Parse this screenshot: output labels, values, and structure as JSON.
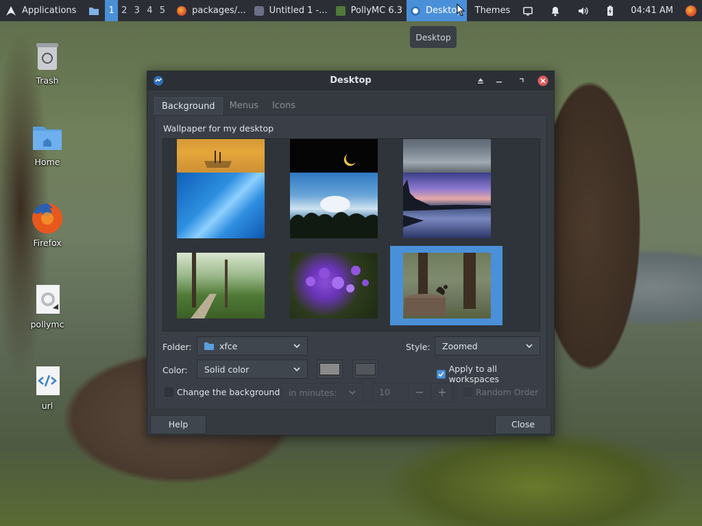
{
  "panel": {
    "applications_label": "Applications",
    "workspaces": [
      "1",
      "2",
      "3",
      "4",
      "5"
    ],
    "active_workspace_index": 0,
    "tasks": [
      {
        "label": "packages/...",
        "icon": "firefox-icon"
      },
      {
        "label": "Untitled 1 -...",
        "icon": "document-icon"
      },
      {
        "label": "PollyMC 6.3",
        "icon": "pollymc-icon"
      },
      {
        "label": "Desktop",
        "icon": "desktop-settings-icon",
        "active": true
      },
      {
        "label": "Themes",
        "icon": ""
      }
    ],
    "clock": "04:41 AM",
    "accent": "#4a90d9"
  },
  "tooltip": "Desktop",
  "desktop_icons": [
    {
      "label": "Trash",
      "icon": "trash-icon"
    },
    {
      "label": "Home",
      "icon": "home-folder-icon"
    },
    {
      "label": "Firefox",
      "icon": "firefox-icon"
    },
    {
      "label": "pollymc",
      "icon": "pollymc-file-icon"
    },
    {
      "label": "url",
      "icon": "html-file-icon"
    }
  ],
  "window": {
    "title": "Desktop",
    "tabs": [
      "Background",
      "Menus",
      "Icons"
    ],
    "active_tab_index": 0,
    "section_label": "Wallpaper for my desktop",
    "wallpapers": [
      {
        "name": "desert-sunset"
      },
      {
        "name": "crescent-moon"
      },
      {
        "name": "cloud-horizon"
      },
      {
        "name": "blue-abstract"
      },
      {
        "name": "sky-clouds-trees"
      },
      {
        "name": "lake-sunset"
      },
      {
        "name": "forest-path"
      },
      {
        "name": "purple-flowers"
      },
      {
        "name": "squirrel-stump",
        "selected": true
      }
    ],
    "folder_label": "Folder:",
    "folder_value": "xfce",
    "style_label": "Style:",
    "style_value": "Zoomed",
    "color_label": "Color:",
    "color_value": "Solid color",
    "primary_color": "#8a8a8a",
    "secondary_color": "#5a5e63",
    "apply_all_label": "Apply to all workspaces",
    "apply_all_checked": true,
    "change_bg_label": "Change the background",
    "change_bg_checked": false,
    "interval_placeholder": "in minutes:",
    "interval_value": "10",
    "random_order_label": "Random Order",
    "help_label": "Help",
    "close_label": "Close"
  }
}
